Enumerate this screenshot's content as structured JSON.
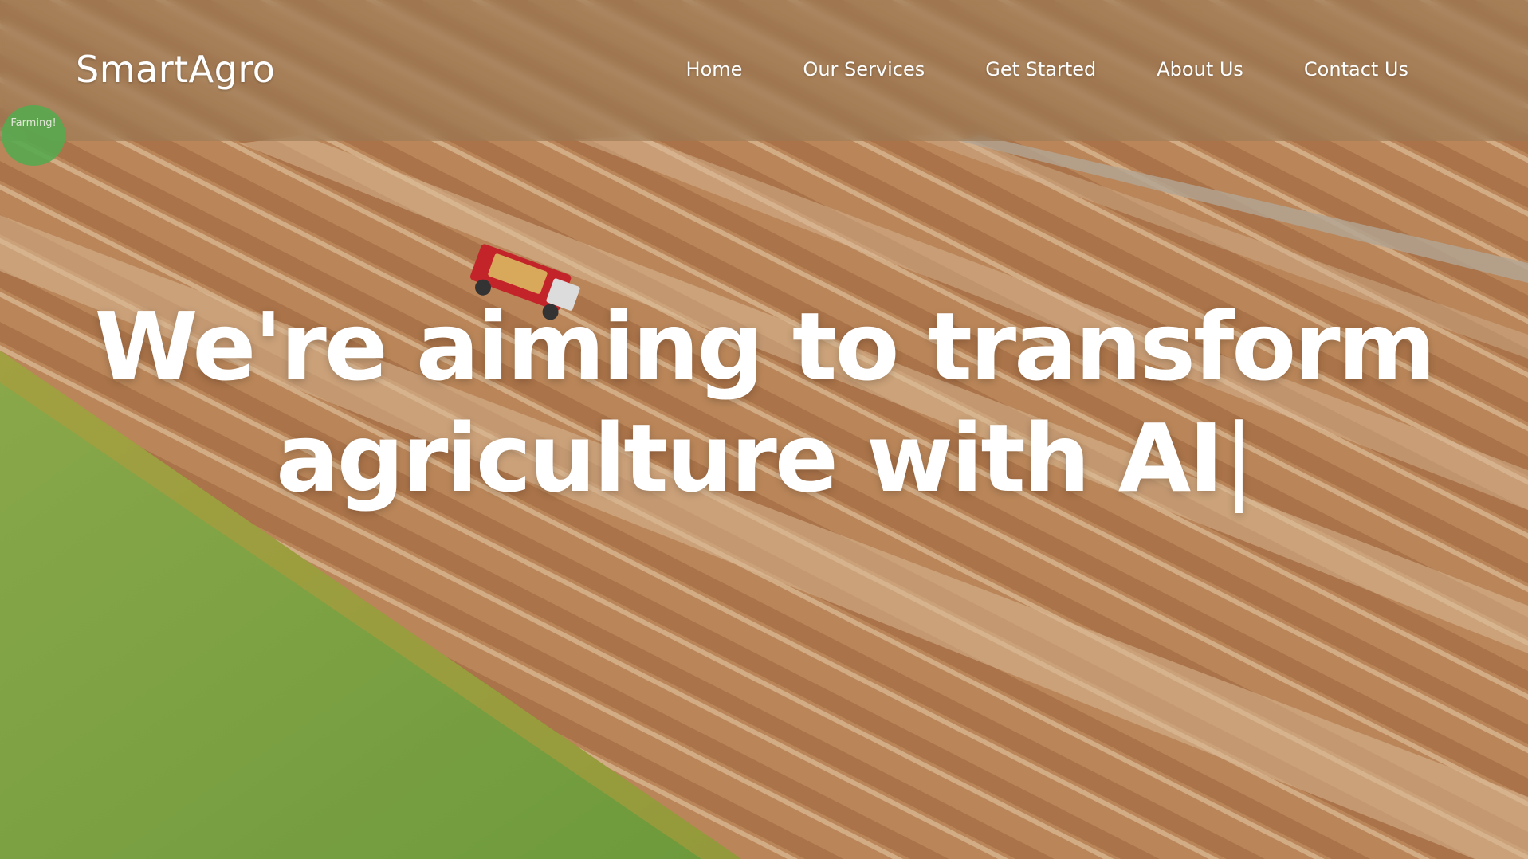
{
  "brand": {
    "name": "SmartAgro"
  },
  "nav": {
    "items": [
      {
        "label": "Home"
      },
      {
        "label": "Our Services"
      },
      {
        "label": "Get Started"
      },
      {
        "label": "About Us"
      },
      {
        "label": "Contact Us"
      }
    ]
  },
  "hero": {
    "headline_line1": "We're aiming to transform",
    "headline_line2": "agriculture with AI",
    "cursor": "|",
    "background_image": "aerial-farm-field-harvester"
  },
  "badge": {
    "label": "Farming!"
  },
  "colors": {
    "nav_text": "#ffffff",
    "headline_text": "#ffffff",
    "navbar_bg": "rgba(150,120,85,0.55)",
    "badge_green": "#58a94f"
  }
}
